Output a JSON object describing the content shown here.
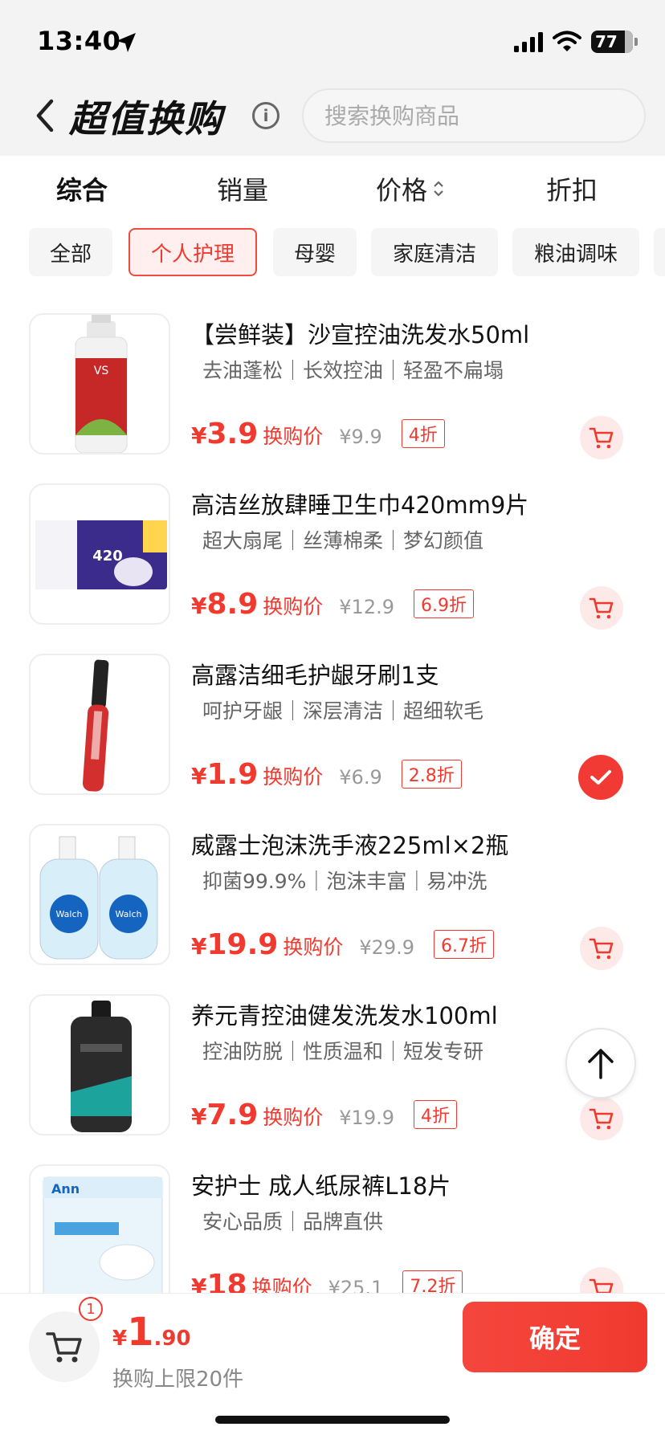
{
  "status_bar": {
    "time": "13:40",
    "battery": "77"
  },
  "header": {
    "title": "超值换购",
    "search_placeholder": "搜索换购商品"
  },
  "sort_tabs": [
    "综合",
    "销量",
    "价格",
    "折扣"
  ],
  "categories": [
    "全部",
    "个人护理",
    "母婴",
    "家庭清洁",
    "粮油调味"
  ],
  "active_category": "个人护理",
  "products": [
    {
      "name": "【尝鲜装】沙宣控油洗发水50ml",
      "tags": "去油蓬松｜长效控油｜轻盈不扁塌",
      "yen": "¥",
      "price": "3.9",
      "price_label": "换购价",
      "original": "¥9.9",
      "discount": "4折",
      "selected": false
    },
    {
      "name": "高洁丝放肆睡卫生巾420mm9片",
      "tags": "超大扇尾｜丝薄棉柔｜梦幻颜值",
      "yen": "¥",
      "price": "8.9",
      "price_label": "换购价",
      "original": "¥12.9",
      "discount": "6.9折",
      "selected": false
    },
    {
      "name": "高露洁细毛护龈牙刷1支",
      "tags": "呵护牙龈｜深层清洁｜超细软毛",
      "yen": "¥",
      "price": "1.9",
      "price_label": "换购价",
      "original": "¥6.9",
      "discount": "2.8折",
      "selected": true
    },
    {
      "name": "威露士泡沫洗手液225ml×2瓶",
      "tags": "抑菌99.9%｜泡沫丰富｜易冲洗",
      "yen": "¥",
      "price": "19.9",
      "price_label": "换购价",
      "original": "¥29.9",
      "discount": "6.7折",
      "selected": false
    },
    {
      "name": "养元青控油健发洗发水100ml",
      "tags": "控油防脱｜性质温和｜短发专研",
      "yen": "¥",
      "price": "7.9",
      "price_label": "换购价",
      "original": "¥19.9",
      "discount": "4折",
      "selected": false
    },
    {
      "name": "安护士 成人纸尿裤L18片",
      "tags": "安心品质｜品牌直供",
      "yen": "¥",
      "price": "18",
      "price_label": "换购价",
      "original": "¥25.1",
      "discount": "7.2折",
      "selected": false
    }
  ],
  "bottom": {
    "cart_count": "1",
    "yen": "¥",
    "total_int": "1",
    "total_dec": ".90",
    "limit_text": "换购上限20件",
    "confirm": "确定"
  },
  "colors": {
    "accent": "#f03a2f",
    "header_bg": "#f3f3f3"
  },
  "icons": [
    "location-arrow-icon",
    "signal-icon",
    "wifi-icon",
    "battery-icon",
    "back-chevron-icon",
    "info-icon",
    "sort-arrows-icon",
    "cart-icon",
    "check-icon",
    "arrow-up-icon"
  ]
}
